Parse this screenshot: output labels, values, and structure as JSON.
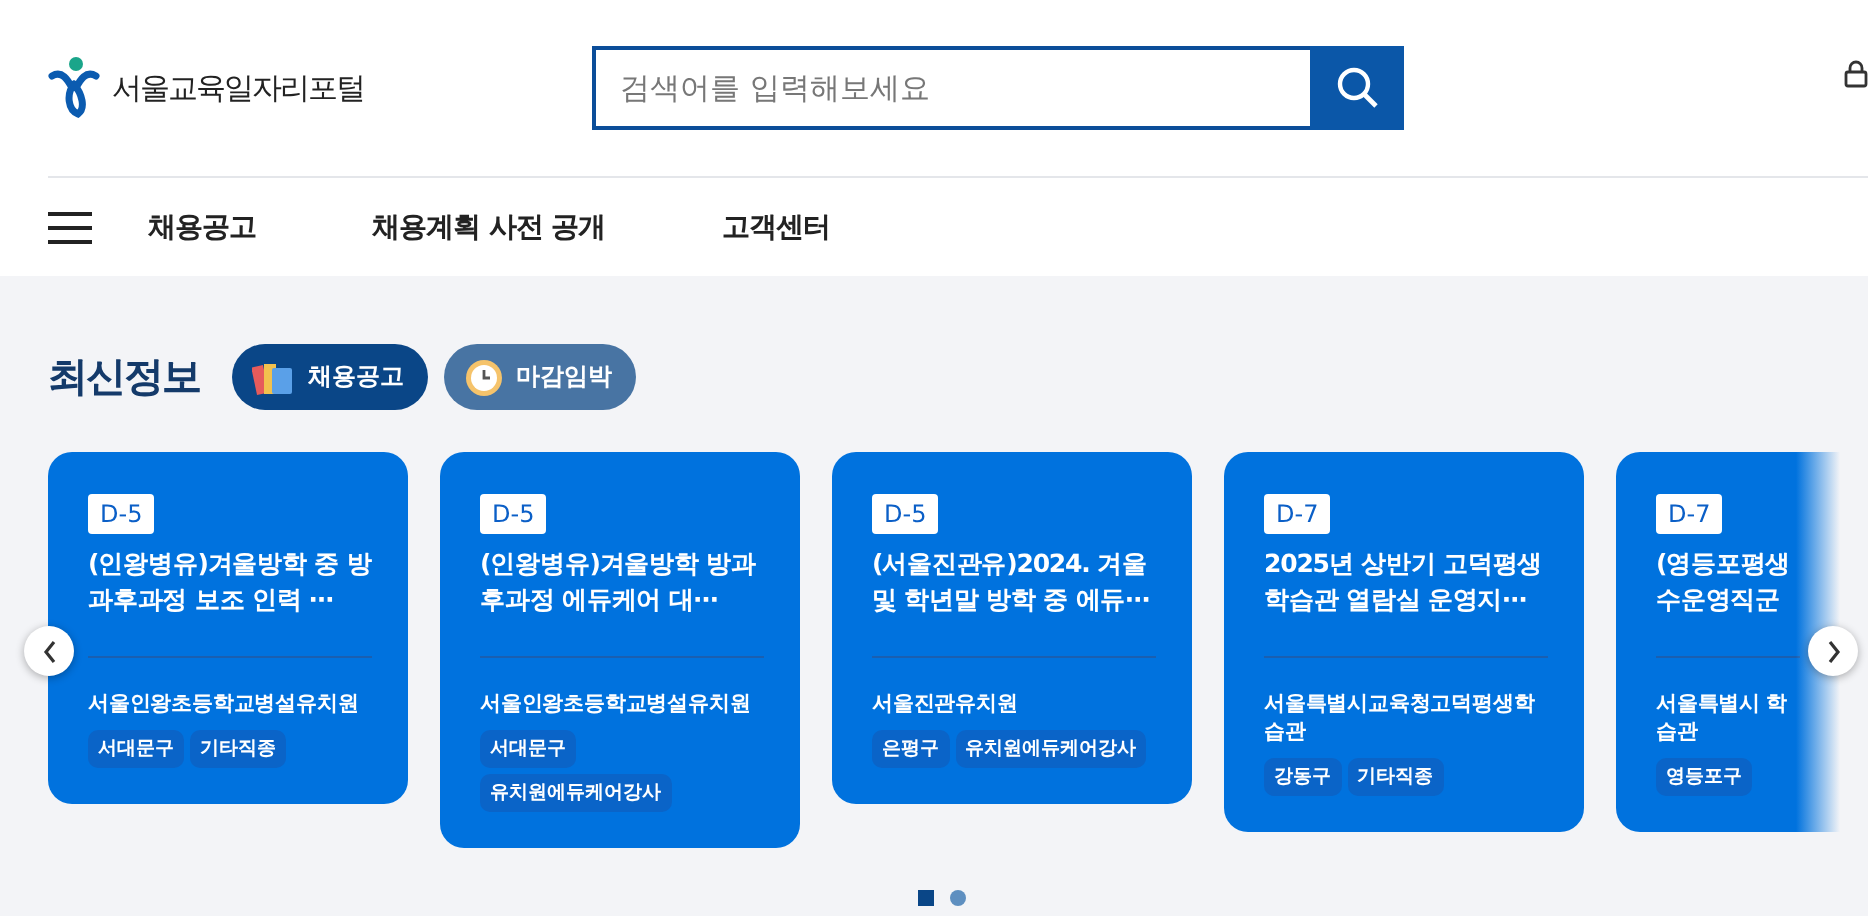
{
  "header": {
    "logo_text": "서울교육일자리포털",
    "search": {
      "placeholder": "검색어를 입력해보세요"
    }
  },
  "nav": {
    "items": [
      {
        "label": "채용공고"
      },
      {
        "label": "채용계획 사전 공개"
      },
      {
        "label": "고객센터"
      }
    ]
  },
  "latest": {
    "title": "최신정보",
    "tabs": [
      {
        "label": "채용공고",
        "kind": "books",
        "selected": true
      },
      {
        "label": "마감임박",
        "kind": "clock",
        "selected": false
      }
    ],
    "cards": [
      {
        "dday": "D-5",
        "title": "(인왕병유)겨울방학 중 방과후과정 보조 인력 ⋯",
        "org": "서울인왕초등학교병설유치원",
        "tags": [
          "서대문구",
          "기타직종"
        ]
      },
      {
        "dday": "D-5",
        "title": "(인왕병유)겨울방학 방과후과정 에듀케어 대⋯",
        "org": "서울인왕초등학교병설유치원",
        "tags": [
          "서대문구",
          "유치원에듀케어강사"
        ]
      },
      {
        "dday": "D-5",
        "title": "(서울진관유)2024. 겨울 및 학년말 방학 중 에듀⋯",
        "org": "서울진관유치원",
        "tags": [
          "은평구",
          "유치원에듀케어강사"
        ]
      },
      {
        "dday": "D-7",
        "title": "2025년 상반기 고덕평생학습관 열람실 운영지⋯",
        "org": "서울특별시교육청고덕평생학습관",
        "tags": [
          "강동구",
          "기타직종"
        ]
      },
      {
        "dday": "D-7",
        "title": "(영등포평생 수운영직군",
        "org": "서울특별시 학습관",
        "tags": [
          "영등포구"
        ]
      }
    ],
    "pages": [
      {
        "selected": true
      },
      {
        "selected": false
      }
    ]
  }
}
